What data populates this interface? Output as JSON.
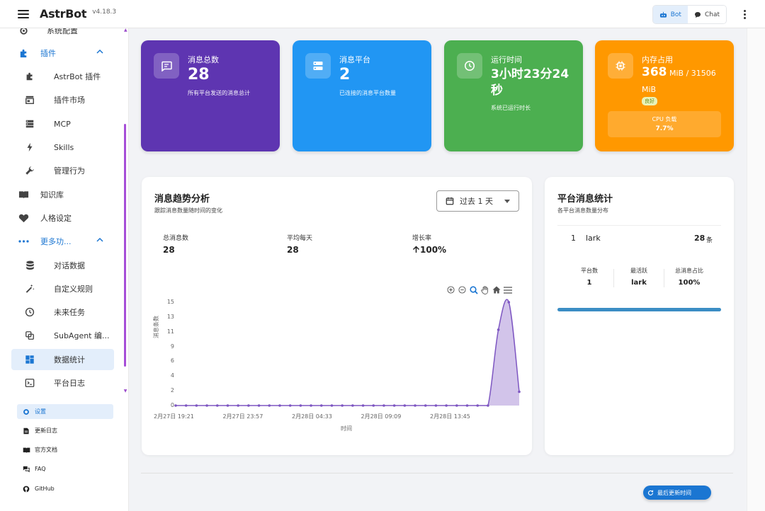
{
  "app": {
    "name": "AstrBot",
    "version": "v4.18.3"
  },
  "topbar": {
    "bot_label": "Bot",
    "chat_label": "Chat"
  },
  "sidebar": {
    "items": [
      {
        "label": "系统配置"
      },
      {
        "label": "插件"
      },
      {
        "label": "AstrBot 插件"
      },
      {
        "label": "插件市场"
      },
      {
        "label": "MCP"
      },
      {
        "label": "Skills"
      },
      {
        "label": "管理行为"
      },
      {
        "label": "知识库"
      },
      {
        "label": "人格设定"
      },
      {
        "label": "更多功..."
      },
      {
        "label": "对话数据"
      },
      {
        "label": "自定义规则"
      },
      {
        "label": "未来任务"
      },
      {
        "label": "SubAgent 编..."
      },
      {
        "label": "数据统计"
      },
      {
        "label": "平台日志"
      }
    ],
    "footer": [
      {
        "label": "设置"
      },
      {
        "label": "更新日志"
      },
      {
        "label": "官方文档"
      },
      {
        "label": "FAQ"
      },
      {
        "label": "GitHub"
      }
    ]
  },
  "cards": {
    "messages": {
      "label": "消息总数",
      "value": "28",
      "desc": "所有平台发送的消息总计",
      "color": "#5e35b1"
    },
    "platforms": {
      "label": "消息平台",
      "value": "2",
      "desc": "已连接的消息平台数量",
      "color": "#2196f3"
    },
    "uptime": {
      "label": "运行时间",
      "value_line1": "3小时23分24",
      "value_line2": "秒",
      "desc": "系统已运行时长",
      "color": "#4caf50"
    },
    "memory": {
      "label": "内存占用",
      "value": "368",
      "unit_part": " MiB / 31506",
      "unit_line2": "MiB",
      "badge": "良好",
      "cpu_label": "CPU 负载",
      "cpu_value": "7.7%",
      "color": "#ff9800"
    }
  },
  "trend": {
    "title": "消息趋势分析",
    "subtitle": "跟踪消息数量随时间的变化",
    "range": "过去 1 天",
    "metrics": [
      {
        "label": "总消息数",
        "value": "28"
      },
      {
        "label": "平均每天",
        "value": "28"
      },
      {
        "label": "增长率",
        "value": "100%"
      }
    ]
  },
  "chart_data": {
    "type": "area",
    "ylabel": "消息条数",
    "xlabel": "时间",
    "ylim": [
      0,
      15
    ],
    "y_ticks": [
      "0",
      "2",
      "4",
      "6",
      "9",
      "11",
      "13",
      "15"
    ],
    "x_tick_labels": [
      "2月27日 19:21",
      "2月27日 23:57",
      "2月28日 04:33",
      "2月28日 09:09",
      "2月28日 13:45"
    ],
    "series": [
      {
        "color": "#7e57c2",
        "values": [
          0,
          0,
          0,
          0,
          0,
          0,
          0,
          0,
          0,
          0,
          0,
          0,
          0,
          0,
          0,
          0,
          0,
          0,
          0,
          0,
          0,
          0,
          0,
          0,
          0,
          0,
          0,
          0,
          0,
          0,
          0,
          11,
          15,
          2
        ]
      }
    ],
    "grid": false
  },
  "platform": {
    "title": "平台消息统计",
    "subtitle": "各平台消息数量分布",
    "rows": [
      {
        "rank": "1",
        "name": "lark",
        "count": "28",
        "unit": "条"
      }
    ],
    "summary": [
      {
        "label": "平台数",
        "value": "1"
      },
      {
        "label": "最活跃",
        "value": "lark"
      },
      {
        "label": "总消息占比",
        "value": "100%"
      }
    ],
    "bar_fraction": 1.0
  },
  "float_button": {
    "label": "最后更新时间"
  }
}
